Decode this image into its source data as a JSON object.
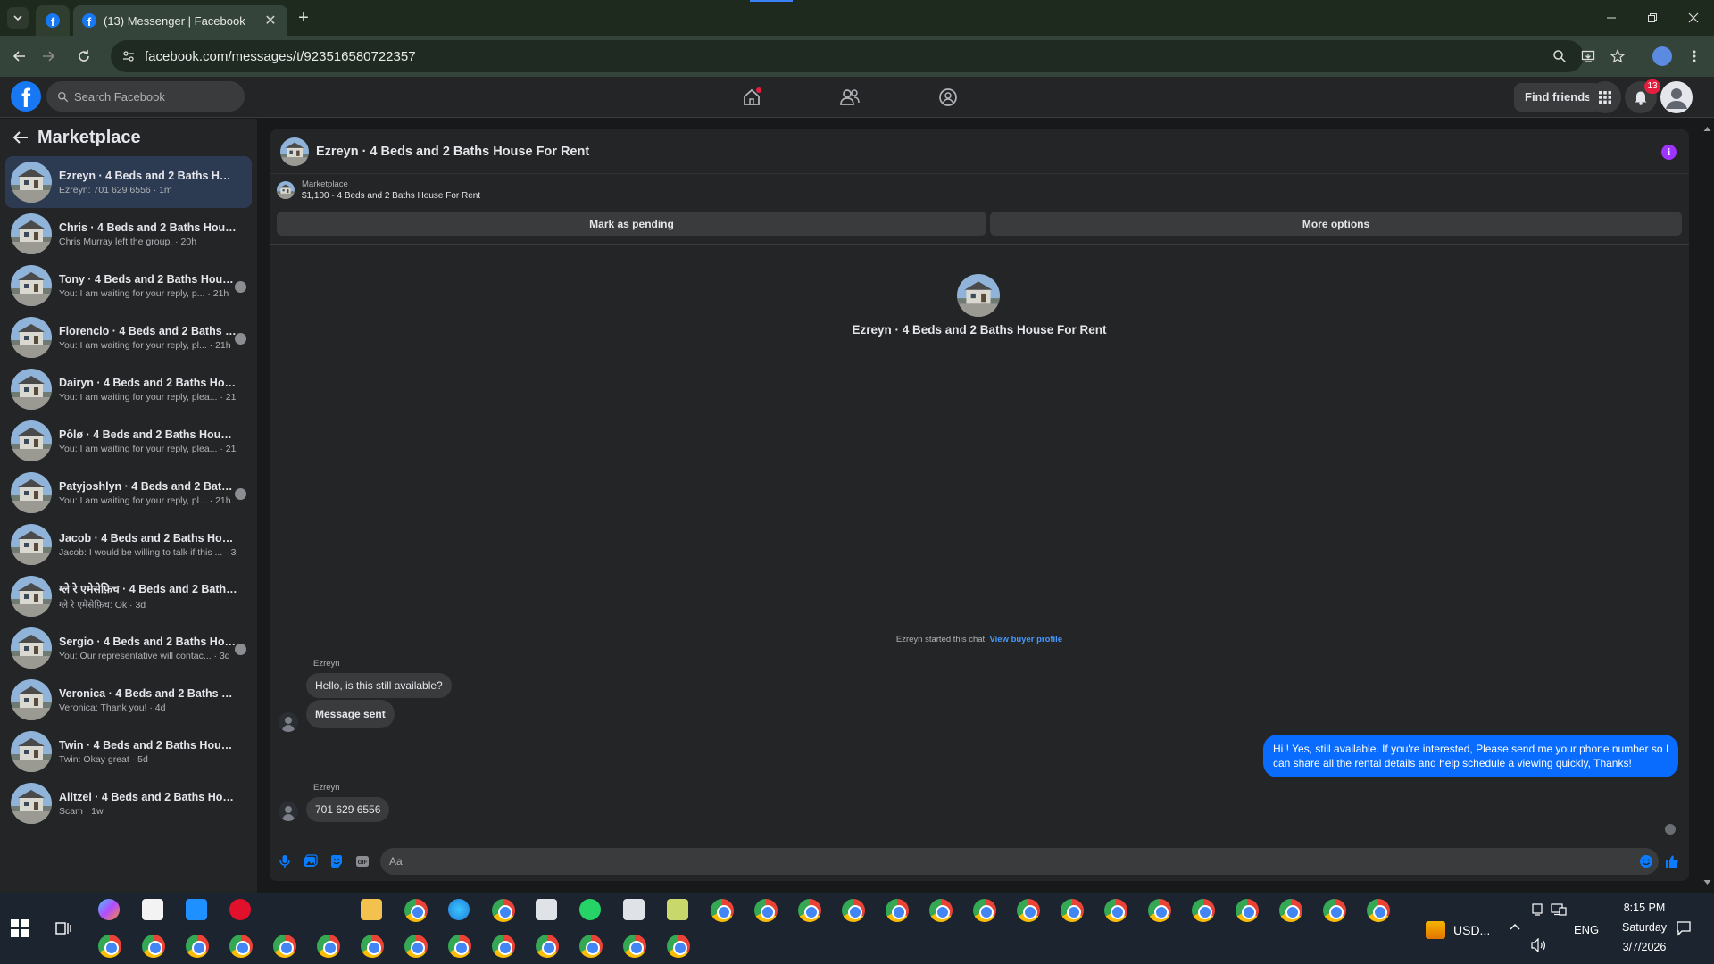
{
  "browser": {
    "tab_title": "(13) Messenger | Facebook",
    "url": "facebook.com/messages/t/923516580722357",
    "new_tab_label": "+",
    "tab_close_label": "✕"
  },
  "fb": {
    "search_placeholder": "Search Facebook",
    "find_friends_label": "Find friends",
    "notification_count": "13",
    "brand_color": "#1877f2"
  },
  "sidebar": {
    "title": "Marketplace",
    "conversations": [
      {
        "name": "Ezreyn · 4 Beds and 2 Baths House...",
        "snippet": "Ezreyn: 701 629 6556 · 1m",
        "active": true
      },
      {
        "name": "Chris · 4 Beds and 2 Baths House F...",
        "snippet": "Chris Murray left the group. · 20h"
      },
      {
        "name": "Tony · 4 Beds and 2 Baths Hous...",
        "snippet": "You: I am waiting for your reply, p... · 21h"
      },
      {
        "name": "Florencio · 4 Beds and 2 Baths H...",
        "snippet": "You: I am waiting for your reply, pl... · 21h"
      },
      {
        "name": "Dairyn · 4 Beds and 2 Baths House...",
        "snippet": "You: I am waiting for your reply, plea... · 21h"
      },
      {
        "name": "Pôlø · 4 Beds and 2 Baths House F...",
        "snippet": "You: I am waiting for your reply, plea... · 21h"
      },
      {
        "name": "Patyjoshlyn · 4 Beds and 2 Baths...",
        "snippet": "You: I am waiting for your reply, pl... · 21h"
      },
      {
        "name": "Jacob · 4 Beds and 2 Baths House ...",
        "snippet": "Jacob: I would be willing to talk if this ... · 3d"
      },
      {
        "name": "ग्ले रे एमेसेफ़िच · 4 Beds and 2 Baths ...",
        "snippet": "ग्ले रे एमेसेफ़िच: Ok · 3d"
      },
      {
        "name": "Sergio · 4 Beds and 2 Baths Hou...",
        "snippet": "You: Our representative will contac... · 3d"
      },
      {
        "name": "Veronica · 4 Beds and 2 Baths Hou...",
        "snippet": "Veronica: Thank you! · 4d"
      },
      {
        "name": "Twin · 4 Beds and 2 Baths House F...",
        "snippet": "Twin: Okay great · 5d"
      },
      {
        "name": "Alitzel · 4 Beds and 2 Baths House ...",
        "snippet": "Scam · 1w"
      }
    ]
  },
  "chat": {
    "title": "Ezreyn · 4 Beds and 2 Baths House For Rent",
    "listing_label": "Marketplace",
    "listing_title": "$1,100 - 4 Beds and 2 Baths House For Rent",
    "mark_pending_label": "Mark as pending",
    "more_options_label": "More options",
    "center_title": "Ezreyn · 4 Beds and 2 Baths House For Rent",
    "started_text": "Ezreyn started this chat.",
    "view_buyer_label": "View buyer profile",
    "sender_1": "Ezreyn",
    "msg_1": "Hello, is this still available?",
    "msg_2": "Message sent",
    "reply_line_1": "Hi ! Yes, still available. If you're interested, Please send me your phone number so I",
    "reply_line_2": "can share all the rental details and help schedule a viewing quickly, Thanks!",
    "sender_2": "Ezreyn",
    "msg_3": "701 629 6556",
    "input_placeholder": "Aa",
    "outgoing_color": "#0a6cff"
  },
  "taskbar": {
    "currency_label": "USD...",
    "language": "ENG",
    "time": "8:15 PM",
    "day": "Saturday",
    "date": "3/7/2026"
  }
}
